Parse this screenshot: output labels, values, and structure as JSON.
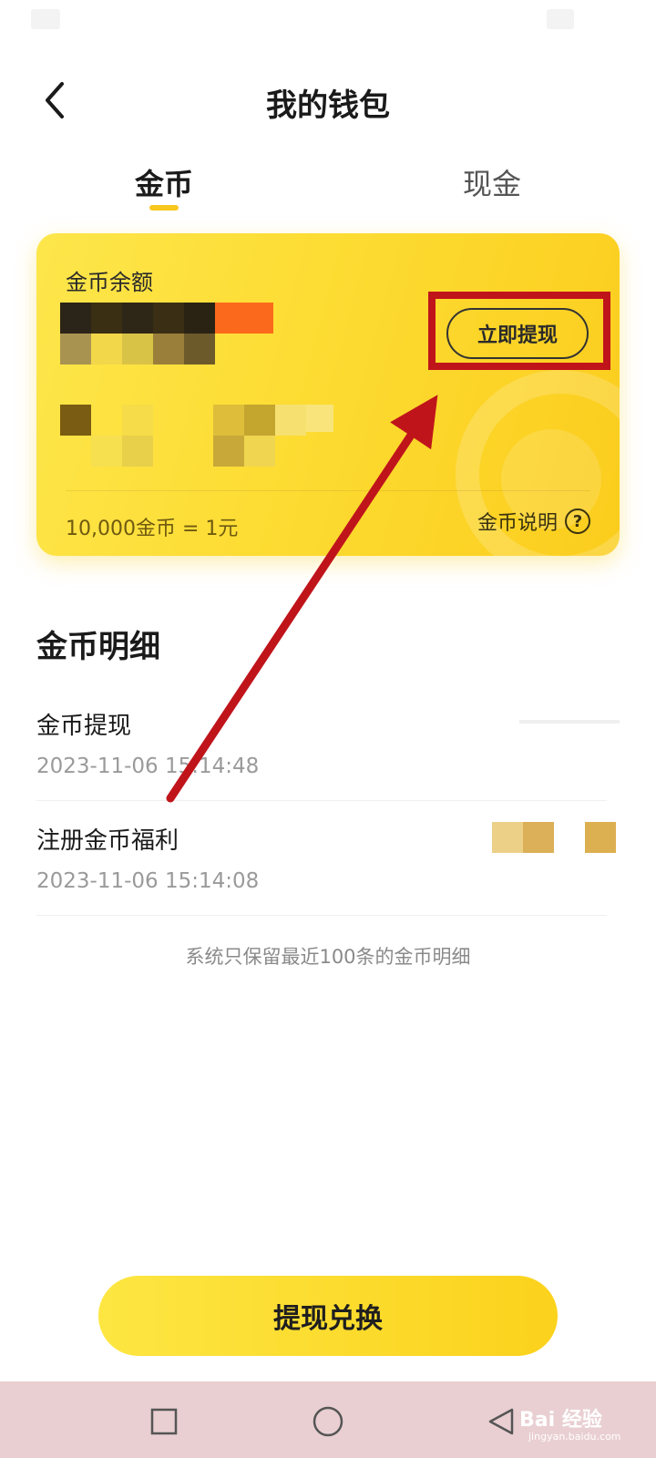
{
  "header": {
    "title": "我的钱包",
    "back_icon": "chevron-left-icon"
  },
  "tabs": [
    {
      "label": "金币",
      "active": true
    },
    {
      "label": "现金",
      "active": false
    }
  ],
  "balance_card": {
    "label": "金币余额",
    "balance_value_masked": true,
    "withdraw_button": "立即提现",
    "rate_text": "10,000金币 = 1元",
    "info_label": "金币说明",
    "info_icon": "help-circle-icon",
    "accent_color": "#fbd21c"
  },
  "details": {
    "title": "金币明细",
    "records": [
      {
        "title": "金币提现",
        "time": "2023-11-06 15:14:48",
        "amount_masked": true
      },
      {
        "title": "注册金币福利",
        "time": "2023-11-06 15:14:08",
        "amount_masked": true
      }
    ],
    "footnote": "系统只保留最近100条的金币明细"
  },
  "primary_button": "提现兑换",
  "nav": {
    "square_icon": "recent-apps-icon",
    "circle_icon": "home-icon",
    "back_icon": "back-triangle-icon"
  },
  "watermark": {
    "text": "Bai 经验",
    "sub": "jingyan.baidu.com"
  },
  "annotation_color": "#c0141b"
}
